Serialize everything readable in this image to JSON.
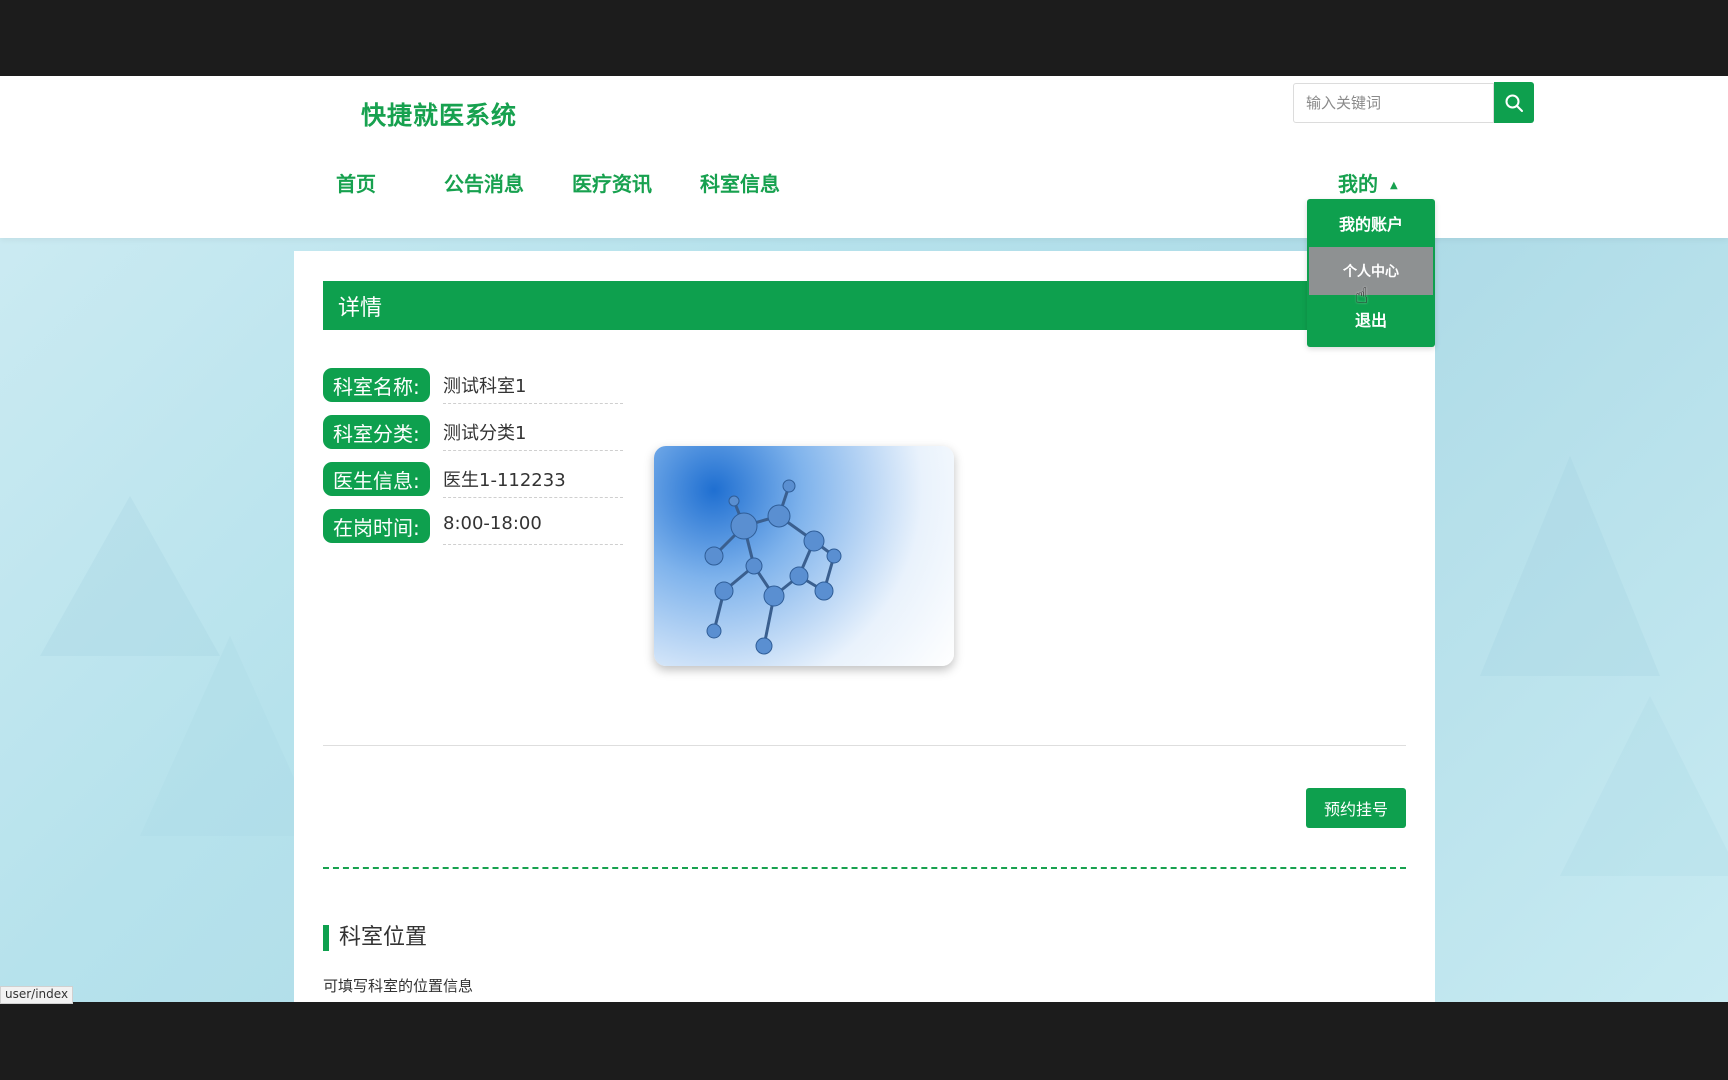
{
  "site": {
    "title": "快捷就医系统"
  },
  "search": {
    "placeholder": "输入关键词"
  },
  "nav": [
    {
      "label": "首页"
    },
    {
      "label": "公告消息"
    },
    {
      "label": "医疗资讯"
    },
    {
      "label": "科室信息"
    }
  ],
  "account_menu": {
    "label": "我的",
    "items": [
      {
        "label": "我的账户"
      },
      {
        "label": "个人中心"
      },
      {
        "label": "退出"
      }
    ]
  },
  "detail": {
    "title": "详情",
    "fields": [
      {
        "label": "科室名称:",
        "value": "测试科室1"
      },
      {
        "label": "科室分类:",
        "value": "测试分类1"
      },
      {
        "label": "医生信息:",
        "value": "医生1-112233"
      },
      {
        "label": "在岗时间:",
        "value": "8:00-18:00"
      }
    ],
    "book_button": "预约挂号",
    "location_title": "科室位置",
    "location_text": "可填写科室的位置信息"
  },
  "status_bar": {
    "url": "user/index"
  },
  "colors": {
    "accent": "#0ea04e",
    "text_green": "#17a14f"
  }
}
